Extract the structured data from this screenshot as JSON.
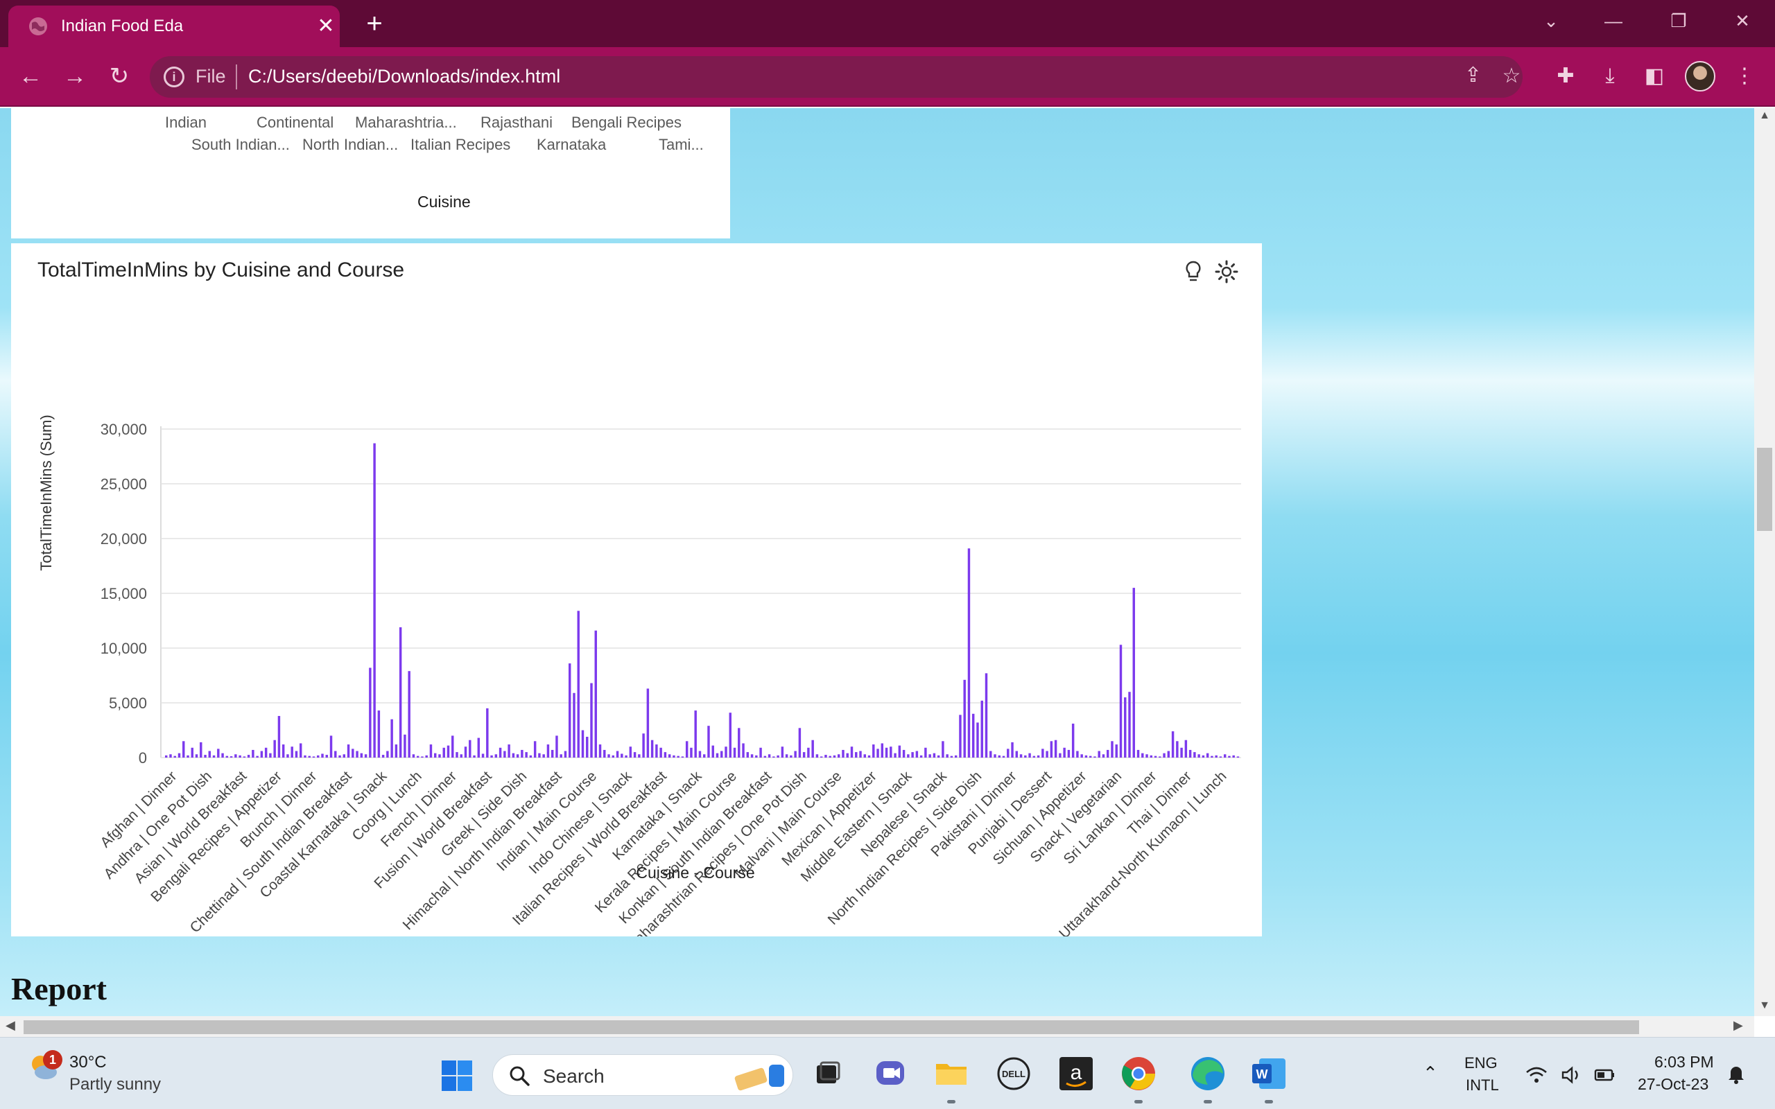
{
  "browser": {
    "tab_title": "Indian Food Eda",
    "omnibox_scheme": "File",
    "url": "C:/Users/deebi/Downloads/index.html"
  },
  "cuisine_chart": {
    "row1": [
      "Indian",
      "Continental",
      "Maharashtria...",
      "Rajasthani",
      "Bengali Recipes"
    ],
    "row2": [
      "South Indian...",
      "North Indian...",
      "Italian Recipes",
      "Karnataka",
      "Tami..."
    ],
    "xlabel": "Cuisine"
  },
  "chart_data": {
    "type": "bar",
    "title": "TotalTimeInMins by Cuisine and Course",
    "xlabel": "Cuisine - Course",
    "ylabel": "TotalTimeInMins (Sum)",
    "ylim": [
      0,
      30000
    ],
    "yticks": [
      "30,000",
      "25,000",
      "20,000",
      "15,000",
      "10,000",
      "5,000",
      "0"
    ],
    "grid": "horizontal",
    "color": "#7c3aed",
    "categories": [
      "Afghan | Dinner",
      "Andhra | One Pot Dish",
      "Asian | World Breakfast",
      "Bengali Recipes | Appetizer",
      "Brunch | Dinner",
      "Chettinad | South Indian Breakfast",
      "Coastal Karnataka | Snack",
      "Coorg | Lunch",
      "French | Dinner",
      "Fusion | World Breakfast",
      "Greek | Side Dish",
      "Himachal | North Indian Breakfast",
      "Indian | Main Course",
      "Indo Chinese | Snack",
      "Italian Recipes | World Breakfast",
      "Karnataka | Snack",
      "Kerala Recipes | Main Course",
      "Konkan | South Indian Breakfast",
      "Maharashtrian Recipes | One Pot Dish",
      "Malvani | Main Course",
      "Mexican | Appetizer",
      "Middle Eastern | Snack",
      "Nepalese | Snack",
      "North Indian Recipes | Side Dish",
      "Pakistani | Dinner",
      "Punjabi | Dessert",
      "Sichuan | Appetizer",
      "Snack | Vegetarian",
      "Sri Lankan | Dinner",
      "Thai | Dinner",
      "Uttarakhand-North Kumaon | Lunch"
    ],
    "values": [
      200,
      300,
      150,
      400,
      1500,
      200,
      900,
      300,
      1400,
      250,
      600,
      200,
      800,
      400,
      150,
      120,
      300,
      200,
      100,
      250,
      700,
      150,
      600,
      900,
      400,
      1600,
      3800,
      1200,
      300,
      1000,
      600,
      1300,
      200,
      150,
      100,
      200,
      350,
      250,
      2000,
      600,
      200,
      300,
      1200,
      800,
      600,
      400,
      300,
      8200,
      28700,
      4300,
      250,
      600,
      3500,
      1200,
      11900,
      2100,
      7900,
      300,
      150,
      100,
      200,
      1200,
      400,
      300,
      900,
      1100,
      2000,
      500,
      300,
      1000,
      1600,
      200,
      1800,
      350,
      4500,
      200,
      300,
      900,
      600,
      1200,
      400,
      300,
      700,
      500,
      200,
      1500,
      400,
      300,
      1200,
      700,
      2000,
      300,
      600,
      8600,
      5900,
      13400,
      2500,
      1900,
      6800,
      11600,
      1200,
      700,
      300,
      200,
      600,
      350,
      200,
      1000,
      500,
      300,
      2200,
      6300,
      1600,
      1200,
      900,
      500,
      300,
      200,
      150,
      100,
      1500,
      900,
      4300,
      600,
      300,
      2900,
      1100,
      400,
      600,
      1000,
      4100,
      900,
      2700,
      1300,
      500,
      300,
      200,
      900,
      150,
      300,
      100,
      200,
      1000,
      300,
      200,
      600,
      2700,
      500,
      900,
      1600,
      300,
      100,
      250,
      150,
      200,
      300,
      700,
      400,
      1000,
      500,
      600,
      300,
      200,
      1200,
      800,
      1300,
      900,
      1000,
      400,
      1100,
      700,
      300,
      500,
      600,
      200,
      900,
      300,
      400,
      200,
      1500,
      300,
      150,
      200,
      3900,
      7100,
      19100,
      4000,
      3200,
      5200,
      7700,
      600,
      300,
      200,
      150,
      800,
      1400,
      600,
      300,
      200,
      400,
      150,
      200,
      800,
      600,
      1500,
      1600,
      400,
      900,
      700,
      3100,
      600,
      300,
      200,
      150,
      100,
      600,
      300,
      700,
      1500,
      1200,
      10300,
      5500,
      6000,
      15500,
      700,
      400,
      300,
      200,
      150,
      100,
      400,
      600,
      2400,
      1500,
      900,
      1600,
      700,
      500,
      300,
      200,
      400,
      150,
      200,
      100,
      300,
      150,
      200,
      100
    ]
  },
  "page": {
    "report_heading": "Report"
  },
  "taskbar": {
    "weather_temp": "30°C",
    "weather_desc": "Partly sunny",
    "weather_badge": "1",
    "search_placeholder": "Search",
    "lang_top": "ENG",
    "lang_bottom": "INTL",
    "time": "6:03 PM",
    "date": "27-Oct-23"
  }
}
